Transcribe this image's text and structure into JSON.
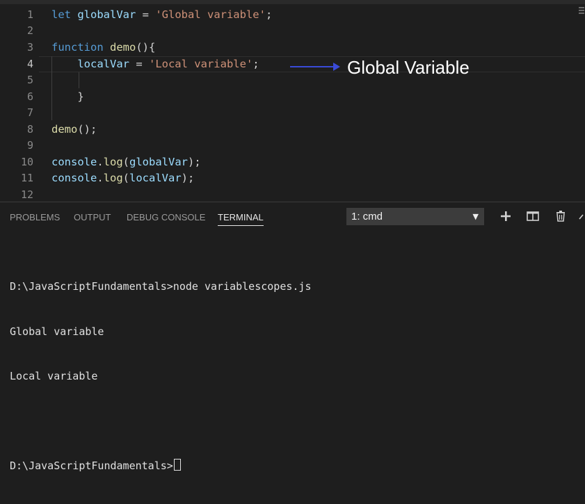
{
  "editor": {
    "lines": [
      {
        "num": "1",
        "tokens": [
          {
            "t": "let ",
            "c": "kw"
          },
          {
            "t": "globalVar",
            "c": "var"
          },
          {
            "t": " = ",
            "c": "def"
          },
          {
            "t": "'Global variable'",
            "c": "str"
          },
          {
            "t": ";",
            "c": "def"
          }
        ]
      },
      {
        "num": "2",
        "tokens": []
      },
      {
        "num": "3",
        "tokens": [
          {
            "t": "function ",
            "c": "kw"
          },
          {
            "t": "demo",
            "c": "fn"
          },
          {
            "t": "(){",
            "c": "def"
          }
        ]
      },
      {
        "num": "4",
        "tokens": [
          {
            "t": "    ",
            "c": "def"
          },
          {
            "t": "localVar",
            "c": "var"
          },
          {
            "t": " = ",
            "c": "def"
          },
          {
            "t": "'Local variable'",
            "c": "str"
          },
          {
            "t": ";",
            "c": "def"
          }
        ]
      },
      {
        "num": "5",
        "tokens": []
      },
      {
        "num": "6",
        "tokens": [
          {
            "t": "    }",
            "c": "def"
          }
        ]
      },
      {
        "num": "7",
        "tokens": []
      },
      {
        "num": "8",
        "tokens": [
          {
            "t": "demo",
            "c": "fn"
          },
          {
            "t": "();",
            "c": "def"
          }
        ]
      },
      {
        "num": "9",
        "tokens": []
      },
      {
        "num": "10",
        "tokens": [
          {
            "t": "console",
            "c": "var"
          },
          {
            "t": ".",
            "c": "def"
          },
          {
            "t": "log",
            "c": "fn"
          },
          {
            "t": "(",
            "c": "def"
          },
          {
            "t": "globalVar",
            "c": "var"
          },
          {
            "t": ");",
            "c": "def"
          }
        ]
      },
      {
        "num": "11",
        "tokens": [
          {
            "t": "console",
            "c": "var"
          },
          {
            "t": ".",
            "c": "def"
          },
          {
            "t": "log",
            "c": "fn"
          },
          {
            "t": "(",
            "c": "def"
          },
          {
            "t": "localVar",
            "c": "var"
          },
          {
            "t": ");",
            "c": "def"
          }
        ]
      },
      {
        "num": "12",
        "tokens": []
      }
    ],
    "annotation": "Global Variable"
  },
  "panel": {
    "tabs": [
      "PROBLEMS",
      "OUTPUT",
      "DEBUG CONSOLE",
      "TERMINAL"
    ],
    "active_tab": "TERMINAL",
    "terminal_select": "1: cmd",
    "icons": [
      "plus-icon",
      "split-terminal-icon",
      "trash-icon",
      "chevron-up-icon"
    ],
    "terminal_lines": [
      "D:\\JavaScriptFundamentals>node variablescopes.js",
      "Global variable",
      "Local variable",
      "",
      "D:\\JavaScriptFundamentals>"
    ]
  },
  "colors": {
    "keyword": "#569cd6",
    "string": "#ce9178",
    "function": "#dcdcaa",
    "variable": "#9cdcfe",
    "arrow": "#3a4bd8",
    "background": "#1e1e1e"
  }
}
